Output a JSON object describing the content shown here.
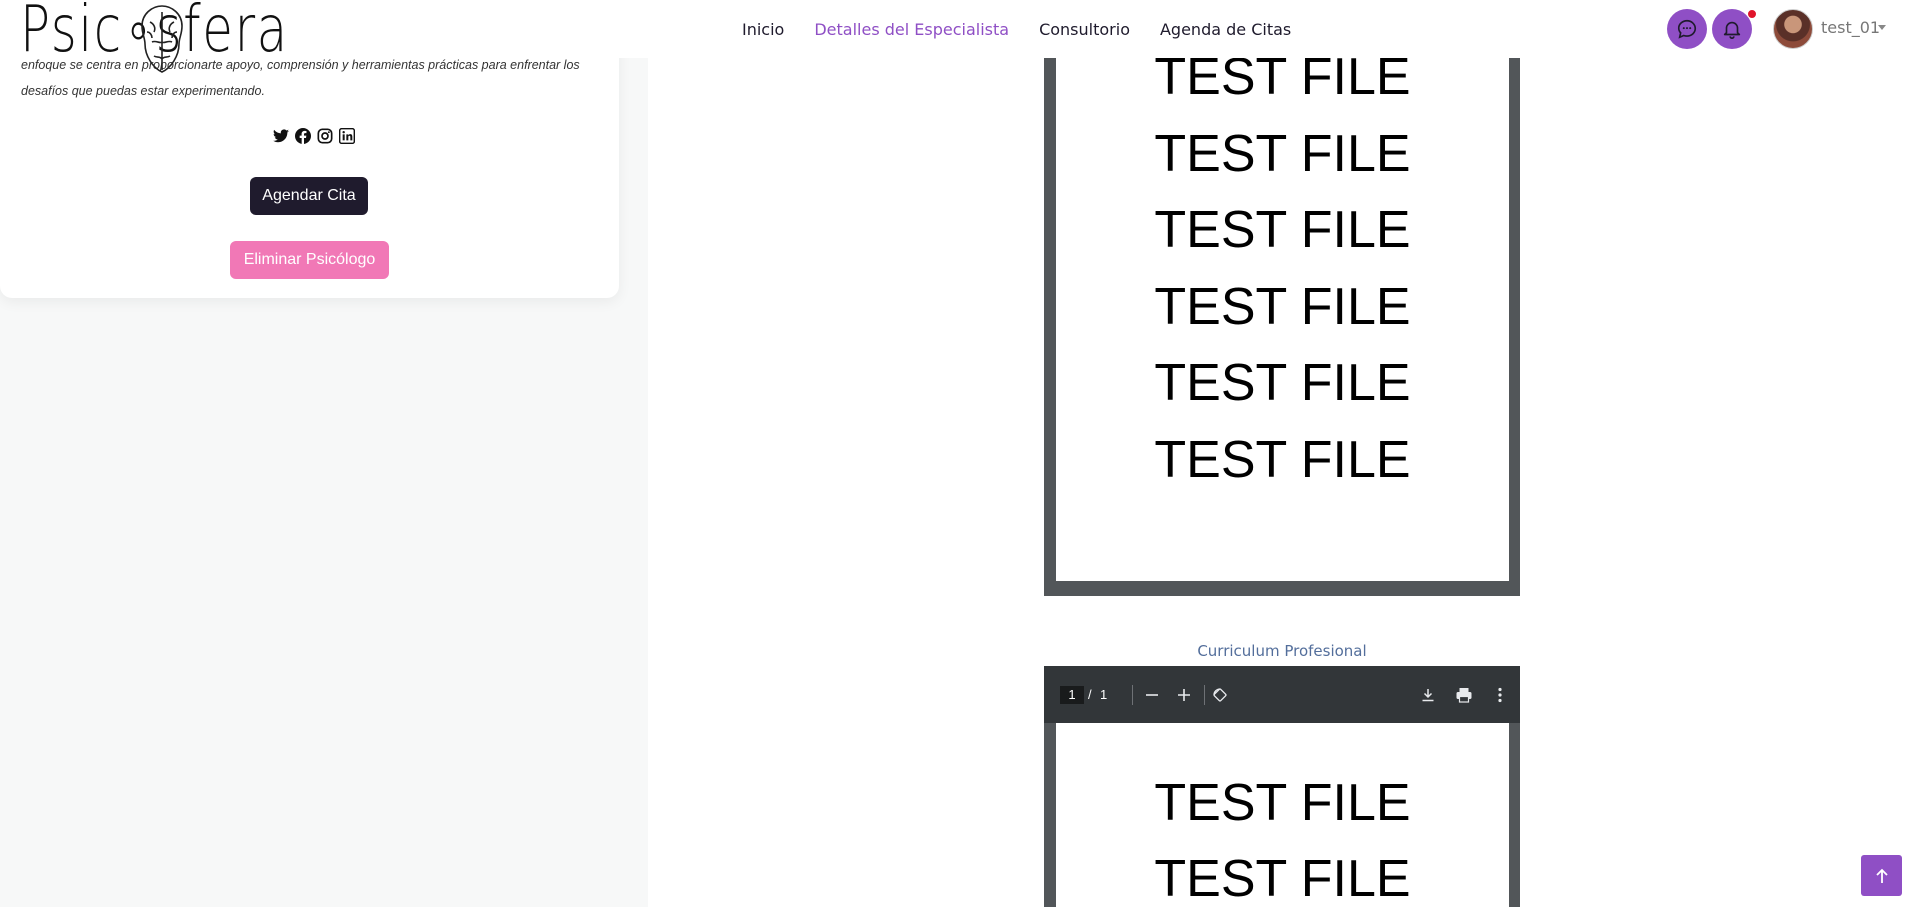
{
  "header": {
    "logo_text": "Psic∘sfera",
    "nav": {
      "inicio": "Inicio",
      "detalles": "Detalles del Especialista",
      "consultorio": "Consultorio",
      "agenda": "Agenda de Citas"
    },
    "user_name": "test_01",
    "icons": [
      "chat-icon",
      "bell-icon"
    ],
    "accent_color": "#8f4fc5"
  },
  "profile": {
    "bio": "enfoque se centra en proporcionarte apoyo, comprensión y herramientas prácticas para enfrentar los desafíos que puedas estar experimentando.",
    "social_icons": [
      "twitter-icon",
      "facebook-icon",
      "instagram-icon",
      "linkedin-icon"
    ],
    "agendar_label": "Agendar Cita",
    "eliminar_label": "Eliminar Psicólogo"
  },
  "pdf_viewer_1": {
    "lines": [
      "TEST FILE",
      "TEST FILE",
      "TEST FILE",
      "TEST FILE",
      "TEST FILE",
      "TEST FILE"
    ]
  },
  "curriculum_caption": "Curriculum Profesional",
  "pdf_viewer_2": {
    "current_page": "1",
    "separator": "/",
    "total_pages": "1",
    "lines": [
      "TEST FILE",
      "TEST FILE"
    ]
  }
}
